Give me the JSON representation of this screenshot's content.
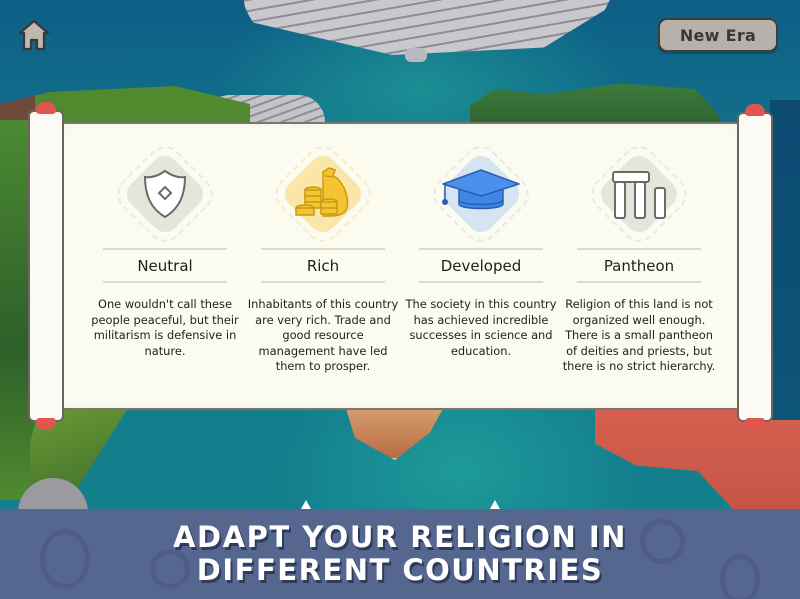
{
  "hud": {
    "home_icon": "home-icon",
    "new_era_label": "New Era"
  },
  "traits": [
    {
      "icon": "shield-icon",
      "title": "Neutral",
      "description": "One wouldn't call these people peaceful, but their militarism is defensive in nature.",
      "color": "#e6e5dc"
    },
    {
      "icon": "money-bag-icon",
      "title": "Rich",
      "description": "Inhabitants of this country are very rich. Trade and good resource management have led them to prosper.",
      "color": "#f6e2a0"
    },
    {
      "icon": "graduation-cap-icon",
      "title": "Developed",
      "description": "The society in this country has achieved incredible successes in science and education.",
      "color": "#d6e3f0"
    },
    {
      "icon": "pillars-icon",
      "title": "Pantheon",
      "description": "Religion of this land is not organized well enough. There is a small pantheon of deities and priests, but there is no strict hierarchy.",
      "color": "#e6e5dc"
    }
  ],
  "banner": {
    "line1": "ADAPT YOUR RELIGION IN",
    "line2": "DIFFERENT COUNTRIES"
  },
  "colors": {
    "accent_red": "#e2554e",
    "banner_bg": "#55668f",
    "paper": "#fbfbf0",
    "gold": "#f5c531",
    "blue": "#3f86e6"
  }
}
